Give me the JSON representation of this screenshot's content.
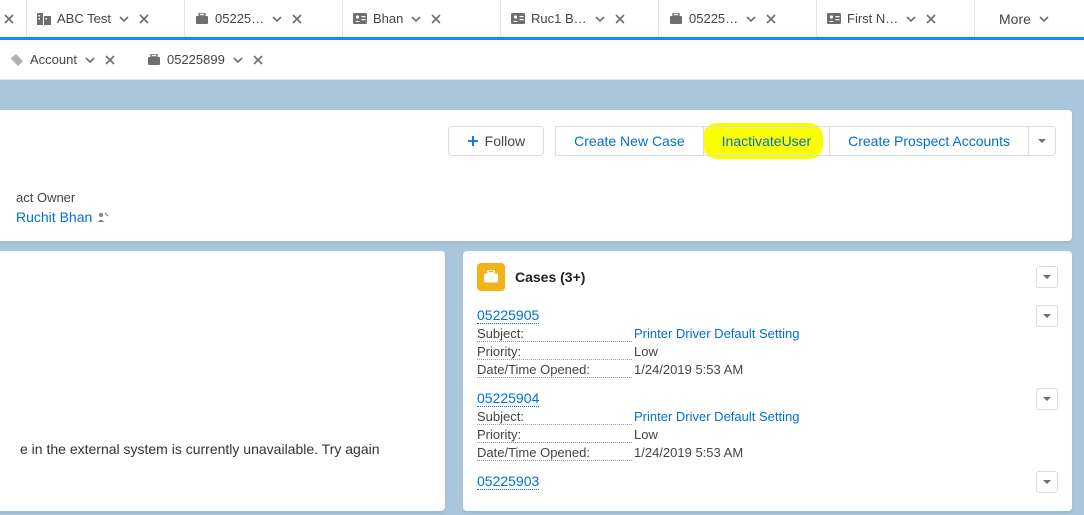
{
  "primaryTabs": [
    {
      "icon": "account-grid",
      "label": "ABC Test"
    },
    {
      "icon": "case",
      "label": "05225…"
    },
    {
      "icon": "contact",
      "label": "Bhan"
    },
    {
      "icon": "contact",
      "label": "Ruc1 B…"
    },
    {
      "icon": "case",
      "label": "05225…"
    },
    {
      "icon": "contact",
      "label": "First N…"
    }
  ],
  "moreLabel": "More",
  "subTabs": [
    {
      "icon": "tag",
      "label": "Account"
    },
    {
      "icon": "case",
      "label": "05225899"
    }
  ],
  "actions": {
    "follow": "Follow",
    "createCase": "Create New Case",
    "inactivateUser": "InactivateUser",
    "createProspect": "Create Prospect Accounts"
  },
  "owner": {
    "label": "act Owner",
    "value": "Ruchit Bhan"
  },
  "leftMsg": "e in the external system is currently unavailable. Try again",
  "related": {
    "title": "Cases (3+)",
    "items": [
      {
        "id": "05225905",
        "subjectK": "Subject:",
        "subjectV": "Printer Driver Default Setting",
        "priorityK": "Priority:",
        "priorityV": "Low",
        "openedK": "Date/Time Opened:",
        "openedV": "1/24/2019 5:53 AM"
      },
      {
        "id": "05225904",
        "subjectK": "Subject:",
        "subjectV": "Printer Driver Default Setting",
        "priorityK": "Priority:",
        "priorityV": "Low",
        "openedK": "Date/Time Opened:",
        "openedV": "1/24/2019 5:53 AM"
      },
      {
        "id": "05225903"
      }
    ]
  }
}
